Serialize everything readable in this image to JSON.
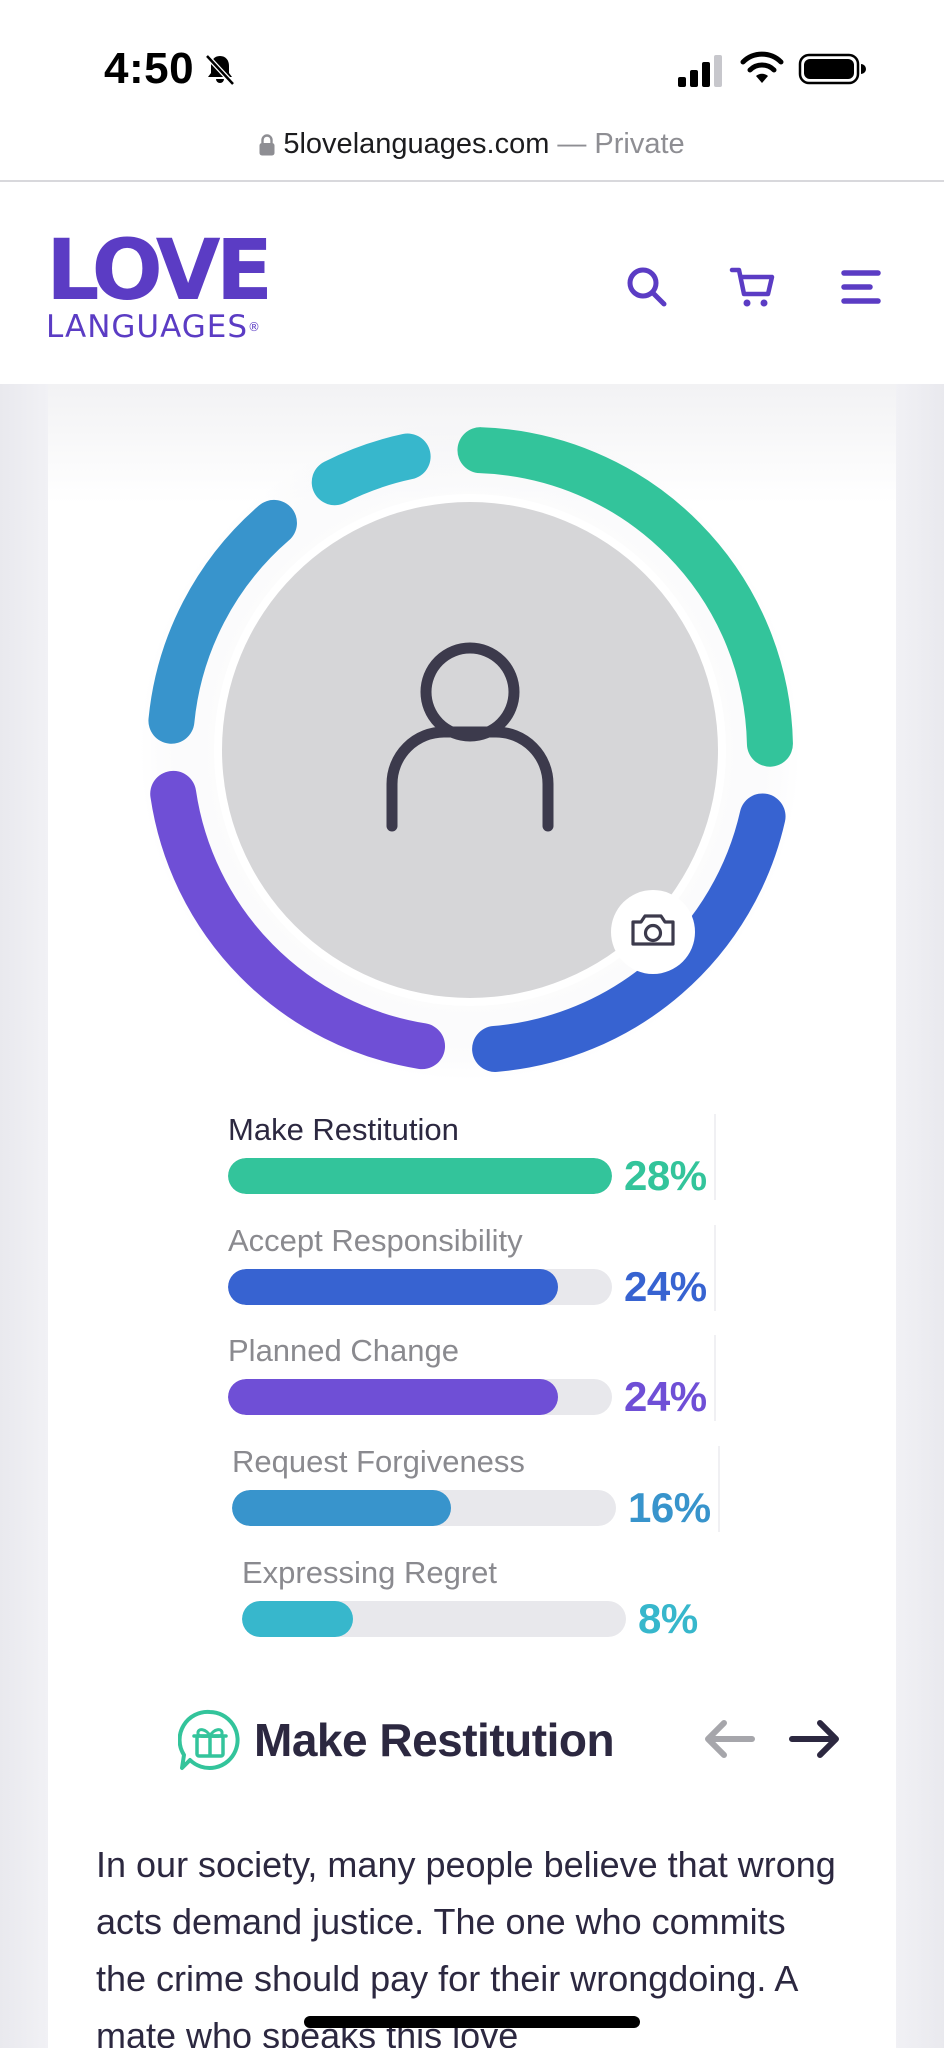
{
  "status_bar": {
    "time": "4:50"
  },
  "browser": {
    "domain": "5lovelanguages.com",
    "separator": "—",
    "mode": "Private"
  },
  "header": {
    "logo_top": "LOVE",
    "logo_bottom": "LANGUAGES",
    "logo_mark": "®",
    "icons": [
      "search-icon",
      "cart-icon",
      "menu-icon"
    ],
    "brand_color": "#5b3cc4"
  },
  "profile": {
    "avatar_icon": "person-icon",
    "camera_icon": "camera-icon"
  },
  "results": [
    {
      "label": "Make Restitution",
      "percent": "28%",
      "value": 28,
      "fill_fraction": 1.0,
      "color": "#33c49b",
      "active": true
    },
    {
      "label": "Accept Responsibility",
      "percent": "24%",
      "value": 24,
      "fill_fraction": 0.86,
      "color": "#3763d1",
      "active": false
    },
    {
      "label": "Planned Change",
      "percent": "24%",
      "value": 24,
      "fill_fraction": 0.86,
      "color": "#6f4fd6",
      "active": false
    },
    {
      "label": "Request Forgiveness",
      "percent": "16%",
      "value": 16,
      "fill_fraction": 0.57,
      "color": "#3894cc",
      "active": false
    },
    {
      "label": "Expressing Regret",
      "percent": "8%",
      "value": 8,
      "fill_fraction": 0.29,
      "color": "#37b7cc",
      "active": false
    }
  ],
  "section": {
    "icon": "gift-icon",
    "title": "Make Restitution",
    "prev_icon": "arrow-left-icon",
    "next_icon": "arrow-right-icon",
    "description": "In our society, many people believe that wrong acts demand justice. The one who commits the crime should pay for their wrongdoing. A mate who speaks this love"
  }
}
